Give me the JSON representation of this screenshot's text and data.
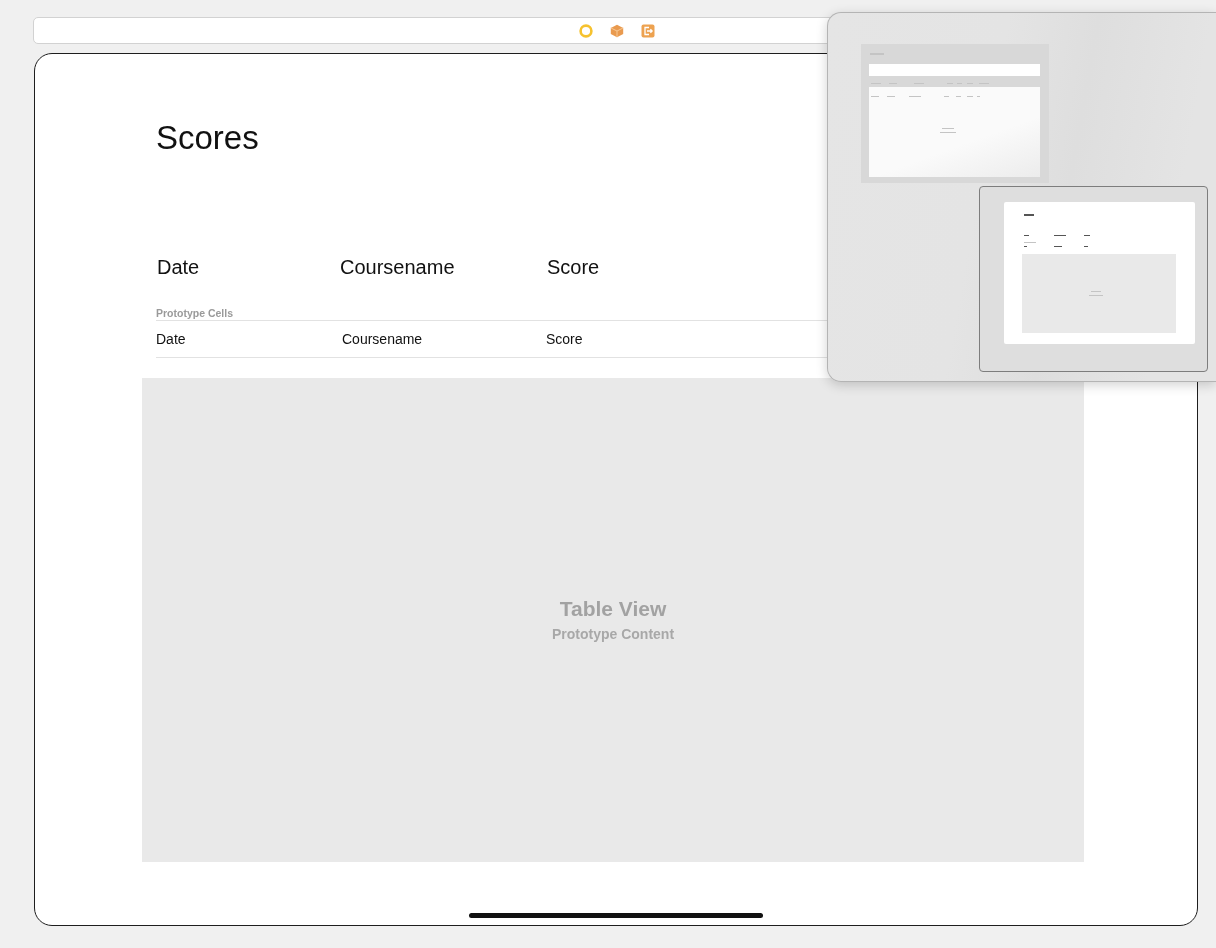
{
  "scene_dock": {
    "icons": [
      {
        "kind": "view_controller"
      },
      {
        "kind": "first_responder"
      },
      {
        "kind": "exit"
      }
    ]
  },
  "scene": {
    "title": "Scores",
    "header_labels": [
      "Date",
      "Coursename",
      "Score"
    ],
    "table": {
      "section_title": "Prototype Cells",
      "prototype_cell": [
        "Date",
        "Coursename",
        "Score"
      ],
      "content_title": "Table View",
      "content_subtitle": "Prototype Content"
    }
  },
  "minimap": {
    "scenes": [
      {
        "selected": false
      },
      {
        "selected": true
      }
    ]
  }
}
